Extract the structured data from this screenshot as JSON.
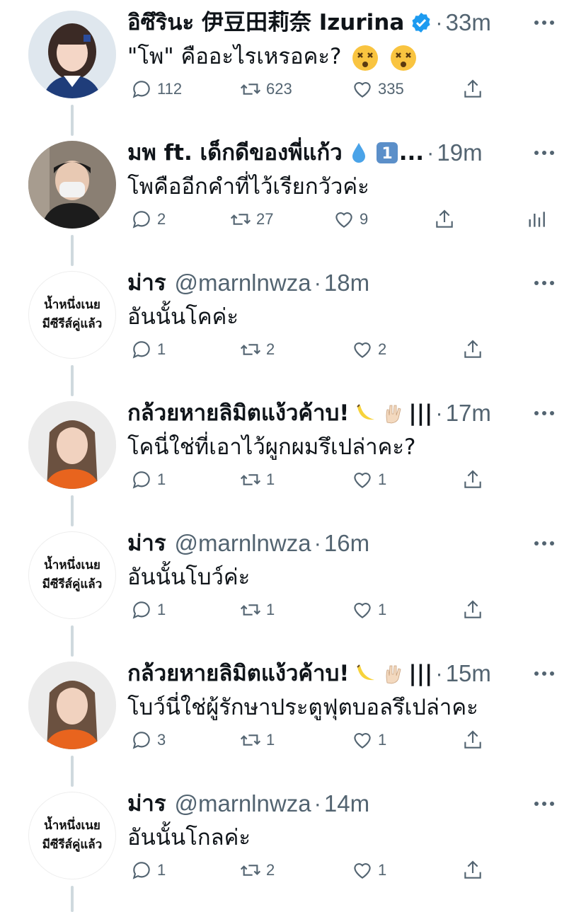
{
  "colors": {
    "text": "#0f1419",
    "muted": "#536471",
    "line": "#cfd9de",
    "verified": "#1d9bf0"
  },
  "tweets": [
    {
      "name": "อิซึรินะ 伊豆田莉奈 Izurina",
      "handle": "",
      "time": "33m",
      "verified": true,
      "avatar": "photo-avatar",
      "text": "\"โพ\" คืออะไรเหรอคะ?",
      "text_emojis": [
        "dizzy-face-icon",
        "dizzy-face-icon"
      ],
      "replies": "112",
      "retweets": "623",
      "likes": "335",
      "analytics": false
    },
    {
      "name": "มพ ft. เด็กดีของพี่แก้ว",
      "name_suffix": "...",
      "name_emojis": [
        "droplet-icon",
        "keycap-one-icon"
      ],
      "handle": "",
      "time": "19m",
      "avatar": "photo-avatar",
      "text": "โพคืออีกคำที่ไว้เรียกวัวค่ะ",
      "replies": "2",
      "retweets": "27",
      "likes": "9",
      "analytics": true
    },
    {
      "name": "ม่าร",
      "handle": "@marnlnwza",
      "time": "18m",
      "avatar_text": [
        "น้ำหนึ่งเนย",
        "มีซีรีส์คู่แล้ว"
      ],
      "text": "อันนั้นโคค่ะ",
      "replies": "1",
      "retweets": "2",
      "likes": "2",
      "analytics": false
    },
    {
      "name": "กล้วยหายลิมิตแง้วค้าบ!",
      "name_emojis": [
        "banana-icon",
        "vulcan-salute-icon"
      ],
      "name_bars": "|||",
      "handle": "",
      "time": "17m",
      "avatar": "photo-avatar",
      "text": "โคนี่ใช่ที่เอาไว้ผูกผมรึเปล่าคะ?",
      "replies": "1",
      "retweets": "1",
      "likes": "1",
      "analytics": false
    },
    {
      "name": "ม่าร",
      "handle": "@marnlnwza",
      "time": "16m",
      "avatar_text": [
        "น้ำหนึ่งเนย",
        "มีซีรีส์คู่แล้ว"
      ],
      "text": "อันนั้นโบว์ค่ะ",
      "replies": "1",
      "retweets": "1",
      "likes": "1",
      "analytics": false
    },
    {
      "name": "กล้วยหายลิมิตแง้วค้าบ!",
      "name_emojis": [
        "banana-icon",
        "vulcan-salute-icon"
      ],
      "name_bars": "|||",
      "handle": "",
      "time": "15m",
      "avatar": "photo-avatar",
      "text": "โบว์นี่ใช่ผู้รักษาประตูฟุตบอลรึเปล่าคะ",
      "replies": "3",
      "retweets": "1",
      "likes": "1",
      "analytics": false
    },
    {
      "name": "ม่าร",
      "handle": "@marnlnwza",
      "time": "14m",
      "avatar_text": [
        "น้ำหนึ่งเนย",
        "มีซีรีส์คู่แล้ว"
      ],
      "text": "อันนั้นโกลค่ะ",
      "replies": "1",
      "retweets": "2",
      "likes": "1",
      "analytics": false
    }
  ]
}
